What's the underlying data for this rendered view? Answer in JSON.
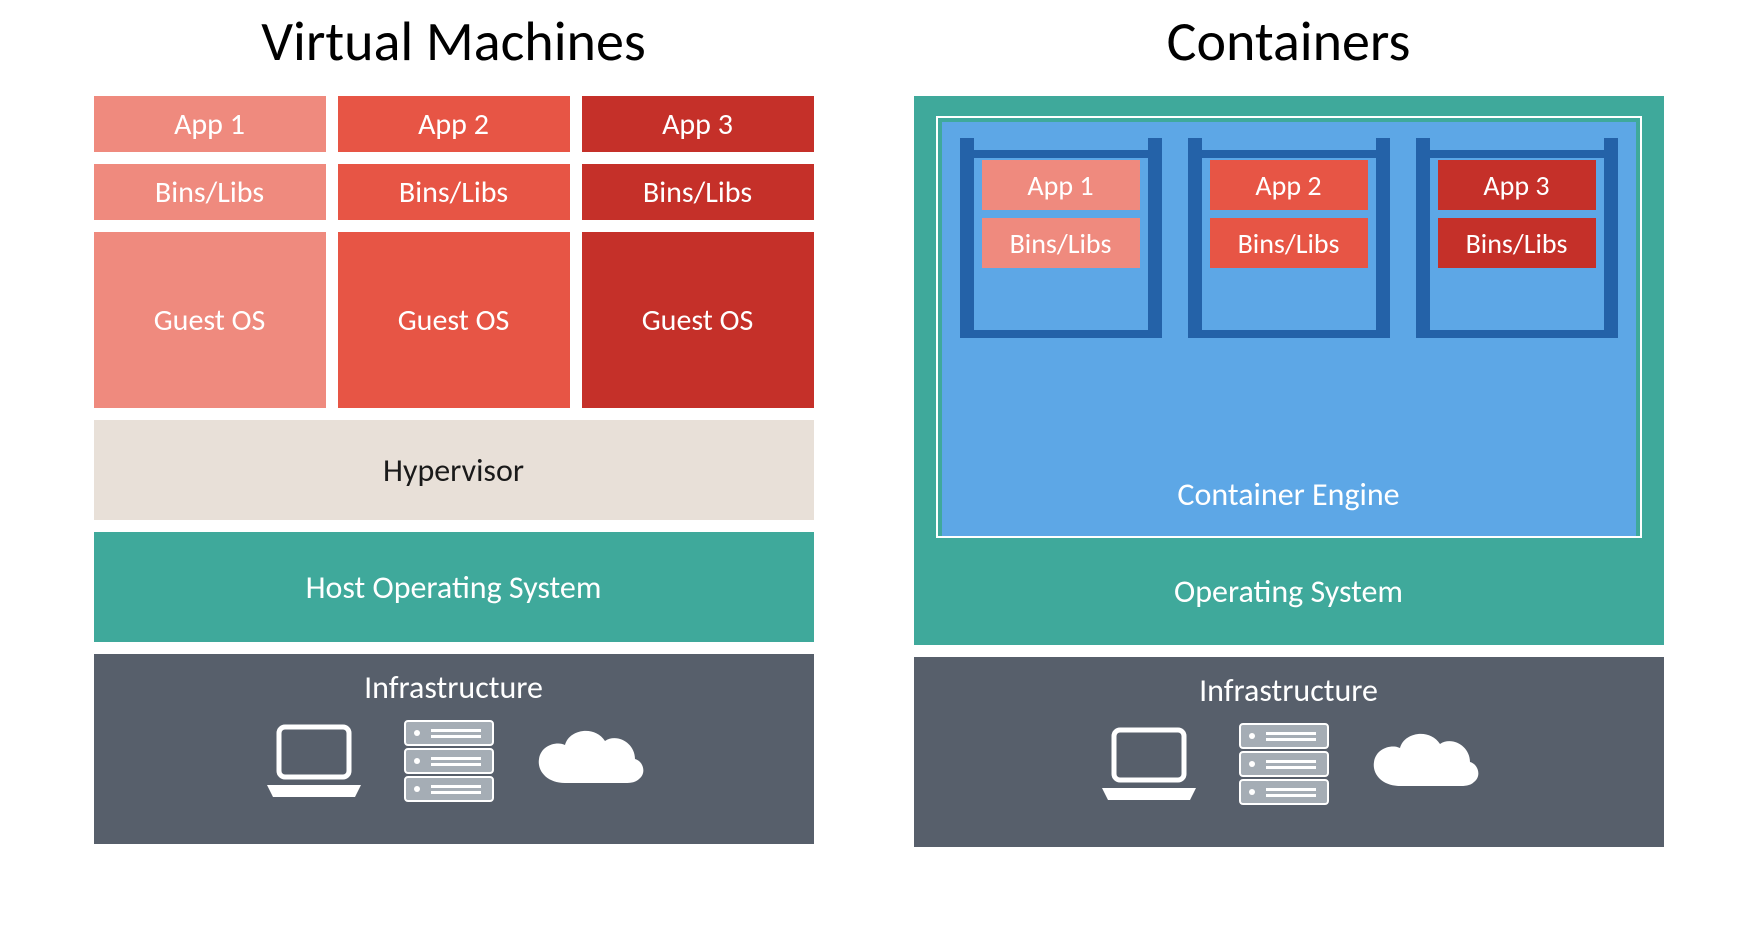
{
  "vm": {
    "title": "Virtual Machines",
    "apps": [
      "App 1",
      "App 2",
      "App 3"
    ],
    "bins": [
      "Bins/Libs",
      "Bins/Libs",
      "Bins/Libs"
    ],
    "guests": [
      "Guest OS",
      "Guest OS",
      "Guest OS"
    ],
    "hypervisor": "Hypervisor",
    "host_os": "Host Operating System",
    "infrastructure": "Infrastructure"
  },
  "ct": {
    "title": "Containers",
    "engine": "Container Engine",
    "shelves": [
      {
        "app": "App 1",
        "bins": "Bins/Libs"
      },
      {
        "app": "App 2",
        "bins": "Bins/Libs"
      },
      {
        "app": "App 3",
        "bins": "Bins/Libs"
      }
    ],
    "os": "Operating System",
    "infrastructure": "Infrastructure"
  },
  "colors": {
    "tier1": "#ef8a7e",
    "tier2": "#e75545",
    "tier3": "#c53029",
    "teal": "#3fa99b",
    "blue": "#5da7e6",
    "darkblue": "#2462a8",
    "infra": "#575f6b",
    "hypervisor_bg": "#e8e0d8"
  }
}
